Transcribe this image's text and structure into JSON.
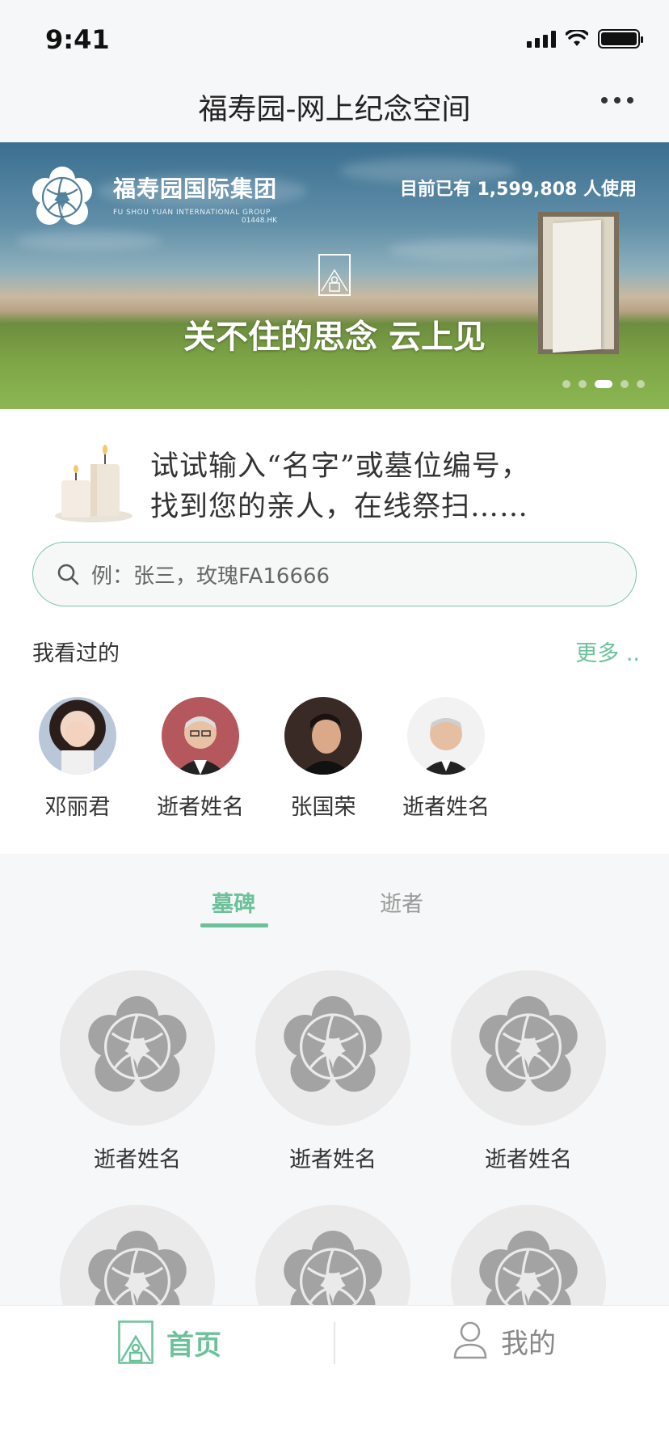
{
  "status_bar": {
    "time": "9:41"
  },
  "header": {
    "title": "福寿园-网上纪念空间"
  },
  "banner": {
    "brand_name": "福寿园国际集团",
    "brand_sub": "FU SHOU YUAN INTERNATIONAL GROUP",
    "brand_code": "01448.HK",
    "user_count": "目前已有 1,599,808 人使用",
    "tagline": "关不住的思念 云上见",
    "active_slide": 3,
    "slide_count": 5
  },
  "intro": {
    "line1": "试试输入“名字”或墓位编号，",
    "line2": "找到您的亲人，在线祭扫……"
  },
  "search": {
    "placeholder": "例：张三，玫瑰FA16666"
  },
  "recent": {
    "title": "我看过的",
    "more": "更多 ..",
    "items": [
      {
        "name": "邓丽君",
        "avatar": "portrait-1"
      },
      {
        "name": "逝者姓名",
        "avatar": "portrait-2"
      },
      {
        "name": "张国荣",
        "avatar": "portrait-3"
      },
      {
        "name": "逝者姓名",
        "avatar": "portrait-4"
      }
    ]
  },
  "tabs": {
    "tombstone": "墓碑",
    "deceased": "逝者",
    "active": "tombstone"
  },
  "grid": {
    "items": [
      {
        "name": "逝者姓名"
      },
      {
        "name": "逝者姓名"
      },
      {
        "name": "逝者姓名"
      },
      {
        "name": ""
      },
      {
        "name": ""
      },
      {
        "name": ""
      }
    ]
  },
  "bottom_nav": {
    "home": "首页",
    "mine": "我的",
    "active": "home"
  },
  "colors": {
    "accent": "#6cc19b",
    "placeholder_gray": "#a0a0a0"
  }
}
